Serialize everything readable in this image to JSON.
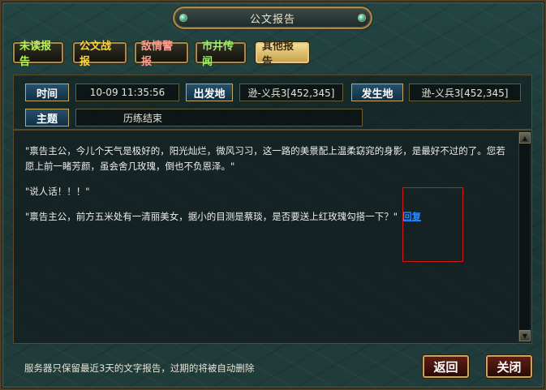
{
  "window": {
    "title": "公文报告"
  },
  "tabs": [
    {
      "label": "未读报告"
    },
    {
      "label": "公文战报"
    },
    {
      "label": "敌情警报"
    },
    {
      "label": "市井传闻"
    },
    {
      "label": "其他报告",
      "active": true
    }
  ],
  "header": {
    "time_label": "时间",
    "time_value": "10-09 11:35:56",
    "origin_label": "出发地",
    "origin_value": "逊-义兵3[452,345]",
    "dest_label": "发生地",
    "dest_value": "逊-义兵3[452,345]",
    "subject_label": "主题",
    "subject_value": "历练结束"
  },
  "body": {
    "paragraphs": [
      "\"禀告主公，今儿个天气是极好的，阳光灿烂，微风习习，这一路的美景配上温柔窈窕的身影，是最好不过的了。您若愿上前一睹芳颜，虽会舍几玫瑰，倒也不负恩泽。\"",
      "\"说人话！！！\"",
      "\"禀告主公，前方五米处有一清丽美女，据小的目测是蔡琰，是否要送上红玫瑰勾搭一下？\""
    ],
    "reply_link": "回复"
  },
  "footer": {
    "note": "服务器只保留最近3天的文字报告，过期的将被自动删除",
    "back_button": "返回",
    "close_button": "关闭"
  },
  "colors": {
    "highlight_box": "#d01818",
    "link": "#2a88ff",
    "active_tab": "#e9c978"
  }
}
